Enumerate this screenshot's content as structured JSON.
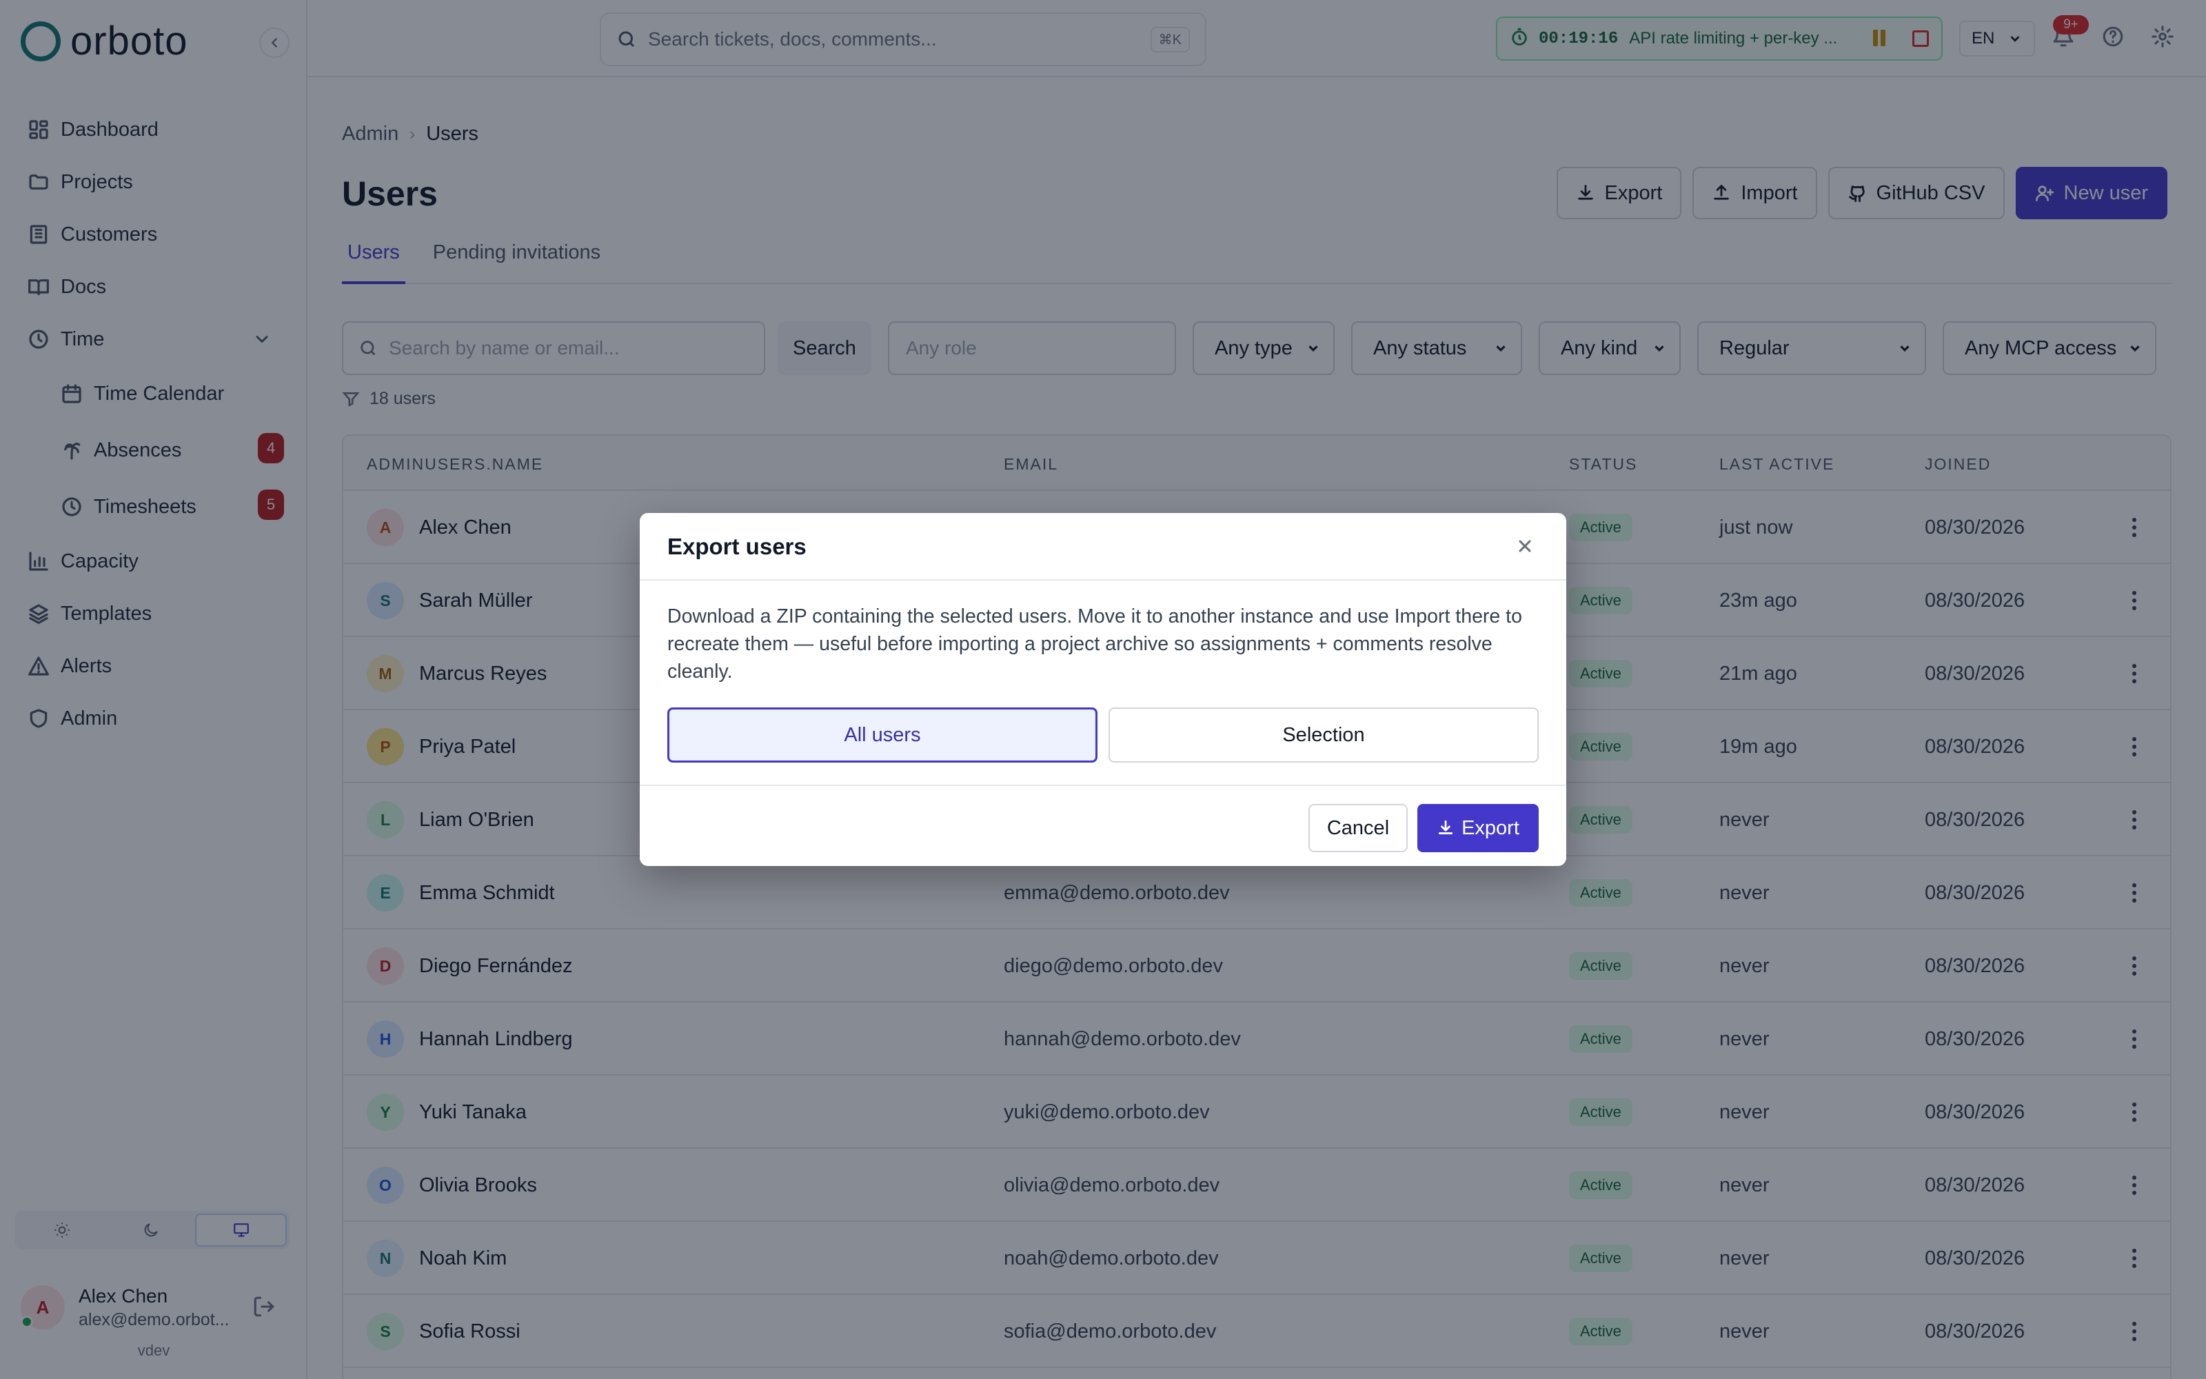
{
  "app": {
    "brand": "orboto",
    "env_label": "vdev"
  },
  "sidebar": {
    "items": [
      {
        "label": "Dashboard",
        "icon": "dashboard-icon"
      },
      {
        "label": "Projects",
        "icon": "folder-icon"
      },
      {
        "label": "Customers",
        "icon": "building-icon"
      },
      {
        "label": "Docs",
        "icon": "book-icon"
      },
      {
        "label": "Time",
        "icon": "clock-icon",
        "expanded": true
      },
      {
        "label": "Time Calendar",
        "icon": "calendar-icon",
        "sub": true
      },
      {
        "label": "Absences",
        "icon": "palm-tree-icon",
        "sub": true,
        "badge": "4"
      },
      {
        "label": "Timesheets",
        "icon": "clock-icon",
        "sub": true,
        "badge": "5"
      },
      {
        "label": "Capacity",
        "icon": "bar-chart-icon"
      },
      {
        "label": "Templates",
        "icon": "layers-icon"
      },
      {
        "label": "Alerts",
        "icon": "alert-triangle-icon"
      },
      {
        "label": "Admin",
        "icon": "shield-icon"
      }
    ],
    "theme_options": [
      "light",
      "dark",
      "system"
    ],
    "theme_selected": "system",
    "user": {
      "initial": "A",
      "name": "Alex Chen",
      "email": "alex@demo.orbot...",
      "online": true
    }
  },
  "topbar": {
    "search_placeholder": "Search tickets, docs, comments...",
    "search_shortcut": "⌘K",
    "timer": {
      "time": "00:19:16",
      "task": "API rate limiting + per-key ..."
    },
    "language": "EN",
    "notifications_badge": "9+"
  },
  "page": {
    "breadcrumb": [
      "Admin",
      "Users"
    ],
    "title": "Users",
    "actions": {
      "export": "Export",
      "import": "Import",
      "github_csv": "GitHub CSV",
      "new_user": "New user"
    },
    "tabs": [
      {
        "label": "Users",
        "active": true
      },
      {
        "label": "Pending invitations",
        "active": false
      }
    ],
    "filters": {
      "search_placeholder": "Search by name or email...",
      "search_button": "Search",
      "role_placeholder": "Any role",
      "type": "Any type",
      "status": "Any status",
      "kind": "Any kind",
      "category": "Regular",
      "mcp_access": "Any MCP access"
    },
    "count_text": "18 users"
  },
  "table": {
    "columns": [
      "ADMINUSERS.NAME",
      "EMAIL",
      "STATUS",
      "LAST ACTIVE",
      "JOINED"
    ],
    "rows": [
      {
        "initial": "A",
        "name": "Alex Chen",
        "email": "",
        "status": "Active",
        "last_active": "just now",
        "joined": "08/30/2026",
        "avatar_bg": "#fde2e2",
        "avatar_fg": "#b45309"
      },
      {
        "initial": "S",
        "name": "Sarah Müller",
        "email": "",
        "status": "Active",
        "last_active": "23m ago",
        "joined": "08/30/2026",
        "avatar_bg": "#dbeafe",
        "avatar_fg": "#0f766e"
      },
      {
        "initial": "M",
        "name": "Marcus Reyes",
        "email": "",
        "status": "Active",
        "last_active": "21m ago",
        "joined": "08/30/2026",
        "avatar_bg": "#fef3c7",
        "avatar_fg": "#a16207"
      },
      {
        "initial": "P",
        "name": "Priya Patel",
        "email": "",
        "status": "Active",
        "last_active": "19m ago",
        "joined": "08/30/2026",
        "avatar_bg": "#fde68a",
        "avatar_fg": "#b45309"
      },
      {
        "initial": "L",
        "name": "Liam O'Brien",
        "email": "",
        "status": "Active",
        "last_active": "never",
        "joined": "08/30/2026",
        "avatar_bg": "#dcfce7",
        "avatar_fg": "#15803d"
      },
      {
        "initial": "E",
        "name": "Emma Schmidt",
        "email": "emma@demo.orboto.dev",
        "status": "Active",
        "last_active": "never",
        "joined": "08/30/2026",
        "avatar_bg": "#ccfbf1",
        "avatar_fg": "#0f766e"
      },
      {
        "initial": "D",
        "name": "Diego Fernández",
        "email": "diego@demo.orboto.dev",
        "status": "Active",
        "last_active": "never",
        "joined": "08/30/2026",
        "avatar_bg": "#fde2e2",
        "avatar_fg": "#b91c1c"
      },
      {
        "initial": "H",
        "name": "Hannah Lindberg",
        "email": "hannah@demo.orboto.dev",
        "status": "Active",
        "last_active": "never",
        "joined": "08/30/2026",
        "avatar_bg": "#dbeafe",
        "avatar_fg": "#1d4ed8"
      },
      {
        "initial": "Y",
        "name": "Yuki Tanaka",
        "email": "yuki@demo.orboto.dev",
        "status": "Active",
        "last_active": "never",
        "joined": "08/30/2026",
        "avatar_bg": "#dcfce7",
        "avatar_fg": "#15803d"
      },
      {
        "initial": "O",
        "name": "Olivia Brooks",
        "email": "olivia@demo.orboto.dev",
        "status": "Active",
        "last_active": "never",
        "joined": "08/30/2026",
        "avatar_bg": "#dbeafe",
        "avatar_fg": "#1d4ed8"
      },
      {
        "initial": "N",
        "name": "Noah Kim",
        "email": "noah@demo.orboto.dev",
        "status": "Active",
        "last_active": "never",
        "joined": "08/30/2026",
        "avatar_bg": "#e0f2fe",
        "avatar_fg": "#0f766e"
      },
      {
        "initial": "S",
        "name": "Sofia Rossi",
        "email": "sofia@demo.orboto.dev",
        "status": "Active",
        "last_active": "never",
        "joined": "08/30/2026",
        "avatar_bg": "#dcfce7",
        "avatar_fg": "#15803d"
      }
    ]
  },
  "modal": {
    "title": "Export users",
    "description": "Download a ZIP containing the selected users. Move it to another instance and use Import there to recreate them — useful before importing a project archive so assignments + comments resolve cleanly.",
    "options": [
      {
        "label": "All users",
        "selected": true
      },
      {
        "label": "Selection",
        "selected": false
      }
    ],
    "cancel": "Cancel",
    "confirm": "Export"
  },
  "colors": {
    "accent": "#4338ca",
    "status_active_bg": "#dcfce7",
    "status_active_fg": "#166534",
    "badge_red": "#b91c1c",
    "logo_teal": "#0f766e"
  }
}
